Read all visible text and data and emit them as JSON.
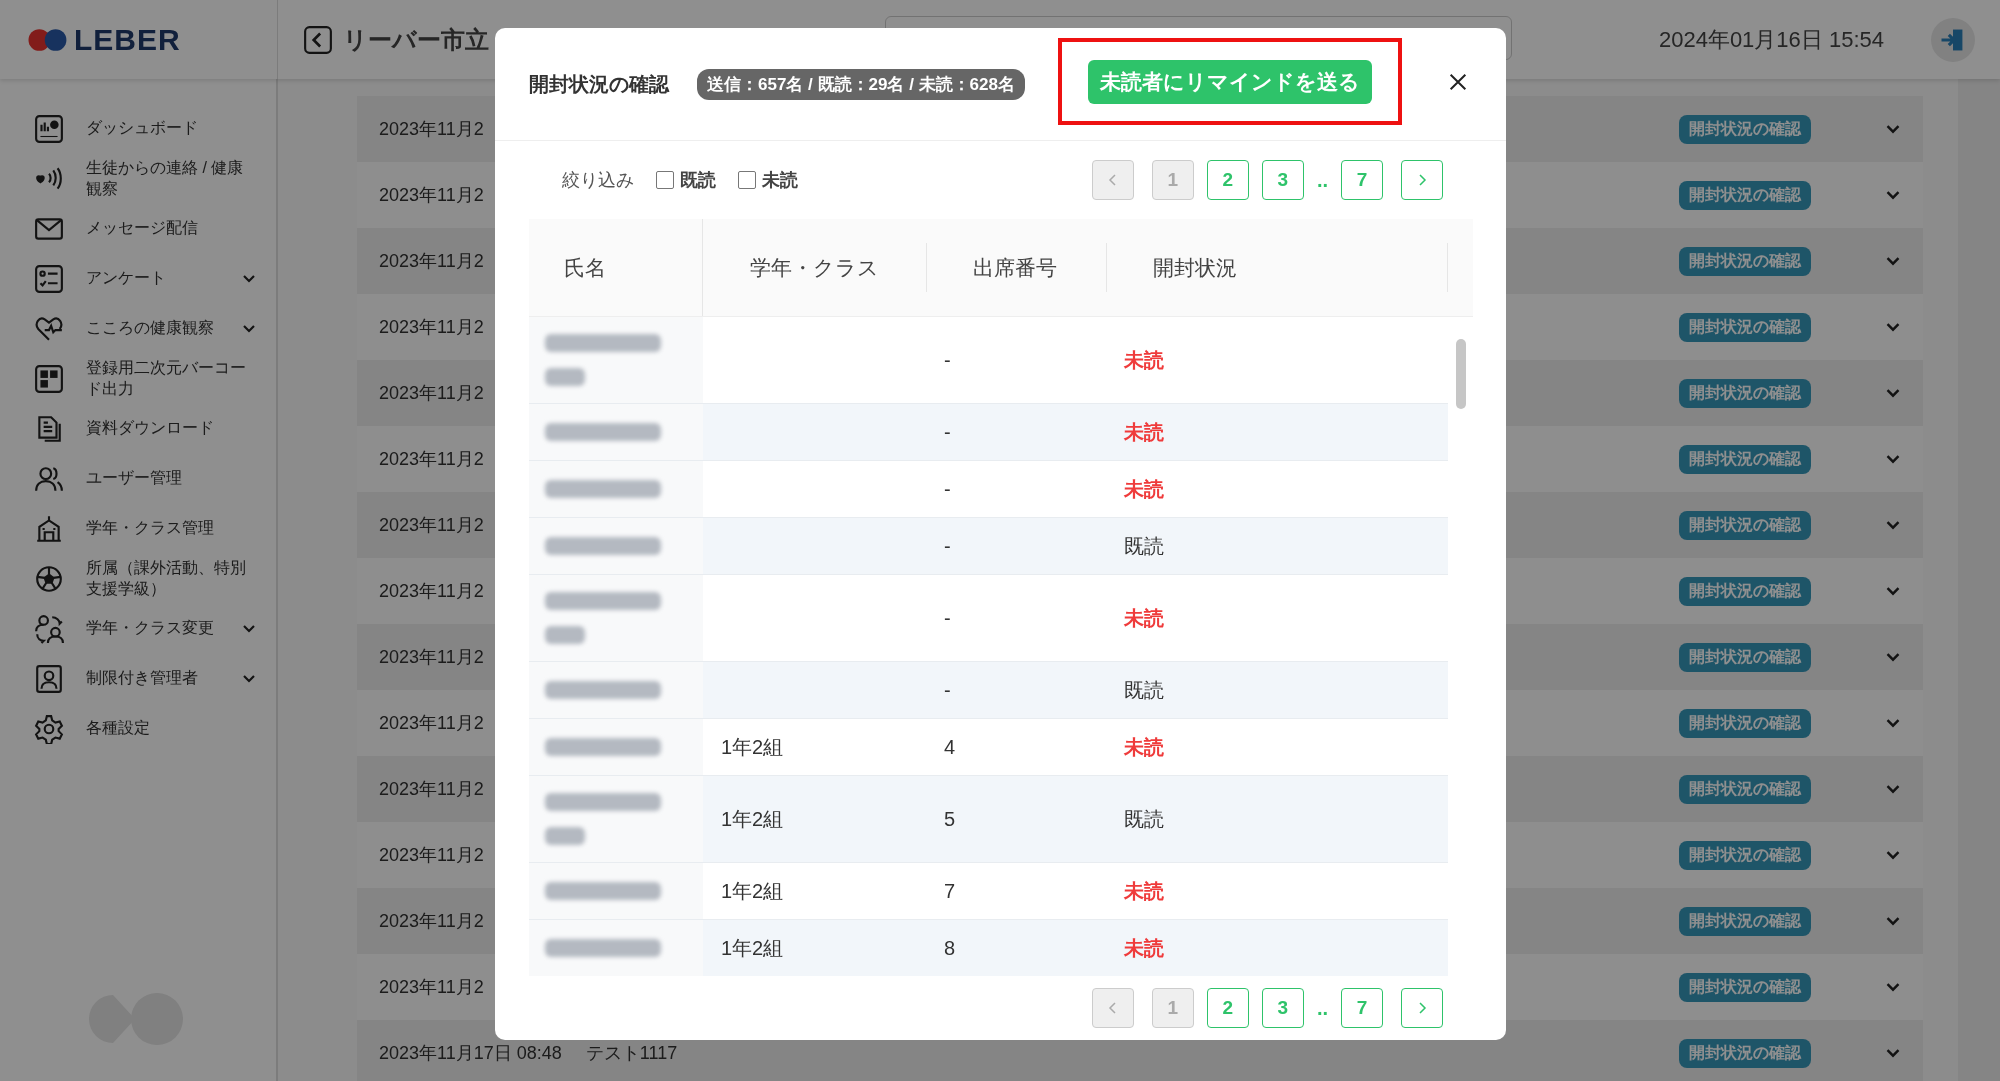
{
  "header": {
    "logo": "LEBER",
    "title": "リーバー市立",
    "datetime": "2024年01月16日 15:54"
  },
  "sidebar": {
    "items": [
      {
        "label": "ダッシュボード",
        "expandable": false
      },
      {
        "label": "生徒からの連絡 / 健康観察",
        "expandable": false
      },
      {
        "label": "メッセージ配信",
        "expandable": false
      },
      {
        "label": "アンケート",
        "expandable": true
      },
      {
        "label": "こころの健康観察",
        "expandable": true
      },
      {
        "label": "登録用二次元バーコード出力",
        "expandable": false
      },
      {
        "label": "資料ダウンロード",
        "expandable": false
      },
      {
        "label": "ユーザー管理",
        "expandable": false
      },
      {
        "label": "学年・クラス管理",
        "expandable": false
      },
      {
        "label": "所属（課外活動、特別支援学級）",
        "expandable": false
      },
      {
        "label": "学年・クラス変更",
        "expandable": true
      },
      {
        "label": "制限付き管理者",
        "expandable": true
      },
      {
        "label": "各種設定",
        "expandable": false
      }
    ]
  },
  "list": {
    "rows": [
      {
        "date": "2023年11月2",
        "action": "開封状況の確認"
      },
      {
        "date": "2023年11月2",
        "action": "開封状況の確認"
      },
      {
        "date": "2023年11月2",
        "action": "開封状況の確認"
      },
      {
        "date": "2023年11月2",
        "action": "開封状況の確認"
      },
      {
        "date": "2023年11月2",
        "action": "開封状況の確認"
      },
      {
        "date": "2023年11月2",
        "action": "開封状況の確認"
      },
      {
        "date": "2023年11月2",
        "action": "開封状況の確認"
      },
      {
        "date": "2023年11月2",
        "action": "開封状況の確認"
      },
      {
        "date": "2023年11月2",
        "action": "開封状況の確認"
      },
      {
        "date": "2023年11月2",
        "action": "開封状況の確認"
      },
      {
        "date": "2023年11月2",
        "action": "開封状況の確認"
      },
      {
        "date": "2023年11月2",
        "action": "開封状況の確認"
      },
      {
        "date": "2023年11月2",
        "action": "開封状況の確認"
      },
      {
        "date": "2023年11月2",
        "action": "開封状況の確認"
      },
      {
        "date": "2023年11月17日 08:48",
        "title": "テスト1117",
        "action": "開封状況の確認"
      }
    ]
  },
  "modal": {
    "title": "開封状況の確認",
    "summary": "送信：657名 / 既読：29名 / 未読：628名",
    "remind_button": "未読者にリマインドを送る",
    "remind_highlighted": true,
    "filter": {
      "label": "絞り込み",
      "options": [
        {
          "label": "既読",
          "checked": false
        },
        {
          "label": "未読",
          "checked": false
        }
      ]
    },
    "pagination_top": {
      "prev_disabled": true,
      "pages": [
        {
          "label": "1",
          "kind": "page",
          "selected": true
        },
        {
          "label": "2",
          "kind": "page",
          "selected": false
        },
        {
          "label": "3",
          "kind": "page",
          "selected": false
        },
        {
          "label": "..",
          "kind": "ellipsis"
        },
        {
          "label": "7",
          "kind": "page",
          "selected": false
        }
      ]
    },
    "table": {
      "columns": [
        "氏名",
        "学年・クラス",
        "出席番号",
        "開封状況"
      ],
      "rows": [
        {
          "name_wrapped": true,
          "number": "-",
          "status": "未読",
          "read": false
        },
        {
          "name_wrapped": false,
          "number": "-",
          "status": "未読",
          "read": false
        },
        {
          "name_wrapped": false,
          "number": "-",
          "status": "未読",
          "read": false
        },
        {
          "name_wrapped": false,
          "number": "-",
          "status": "既読",
          "read": true
        },
        {
          "name_wrapped": true,
          "number": "-",
          "status": "未読",
          "read": false
        },
        {
          "name_wrapped": false,
          "number": "-",
          "status": "既読",
          "read": true
        },
        {
          "name_wrapped": false,
          "grade": "1年2組",
          "number": "4",
          "status": "未読",
          "read": false
        },
        {
          "name_wrapped": true,
          "grade": "1年2組",
          "number": "5",
          "status": "既読",
          "read": true
        },
        {
          "name_wrapped": false,
          "grade": "1年2組",
          "number": "7",
          "status": "未読",
          "read": false
        },
        {
          "name_wrapped": false,
          "grade": "1年2組",
          "number": "8",
          "status": "未読",
          "read": false
        }
      ]
    },
    "pagination_bottom": {
      "prev_disabled": true,
      "pages": [
        {
          "label": "1",
          "kind": "page",
          "selected": true
        },
        {
          "label": "2",
          "kind": "page",
          "selected": false
        },
        {
          "label": "3",
          "kind": "page",
          "selected": false
        },
        {
          "label": "..",
          "kind": "ellipsis"
        },
        {
          "label": "7",
          "kind": "page",
          "selected": false
        }
      ]
    }
  }
}
